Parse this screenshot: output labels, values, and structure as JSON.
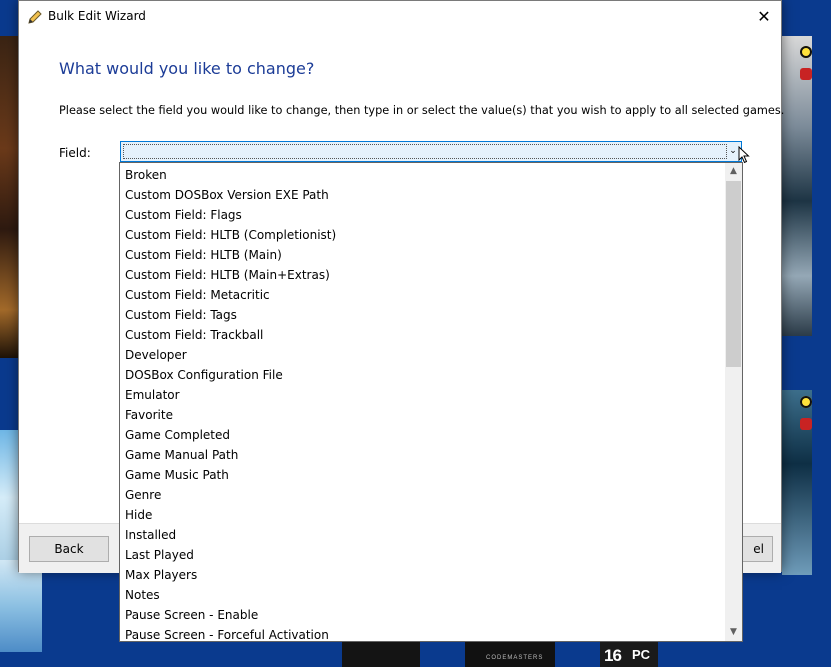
{
  "window": {
    "title": "Bulk Edit Wizard",
    "close_glyph": "✕"
  },
  "page": {
    "heading": "What would you like to change?",
    "instructions": "Please select the field you would like to change, then type in or select the value(s) that you wish to apply to all selected games.",
    "field_label": "Field:"
  },
  "combo": {
    "selected_value": "",
    "arrow_glyph": "⌄"
  },
  "dropdown": {
    "items": [
      "Broken",
      "Custom DOSBox Version EXE Path",
      "Custom Field: Flags",
      "Custom Field: HLTB (Completionist)",
      "Custom Field: HLTB (Main)",
      "Custom Field: HLTB (Main+Extras)",
      "Custom Field: Metacritic",
      "Custom Field: Tags",
      "Custom Field: Trackball",
      "Developer",
      "DOSBox Configuration File",
      "Emulator",
      "Favorite",
      "Game Completed",
      "Game Manual Path",
      "Game Music Path",
      "Genre",
      "Hide",
      "Installed",
      "Last Played",
      "Max Players",
      "Notes",
      "Pause Screen - Enable",
      "Pause Screen - Forceful Activation"
    ],
    "scroll_up_glyph": "▲",
    "scroll_down_glyph": "▼"
  },
  "footer": {
    "back_label": "Back",
    "cancel_label": "el"
  },
  "background": {
    "pegi_rating": "16",
    "pegi_platform": "PC",
    "publisher_text": "CODEMASTERS"
  },
  "colors": {
    "heading": "#1c3c97",
    "accent": "#0078d7",
    "desktop": "#0a3a8e"
  }
}
